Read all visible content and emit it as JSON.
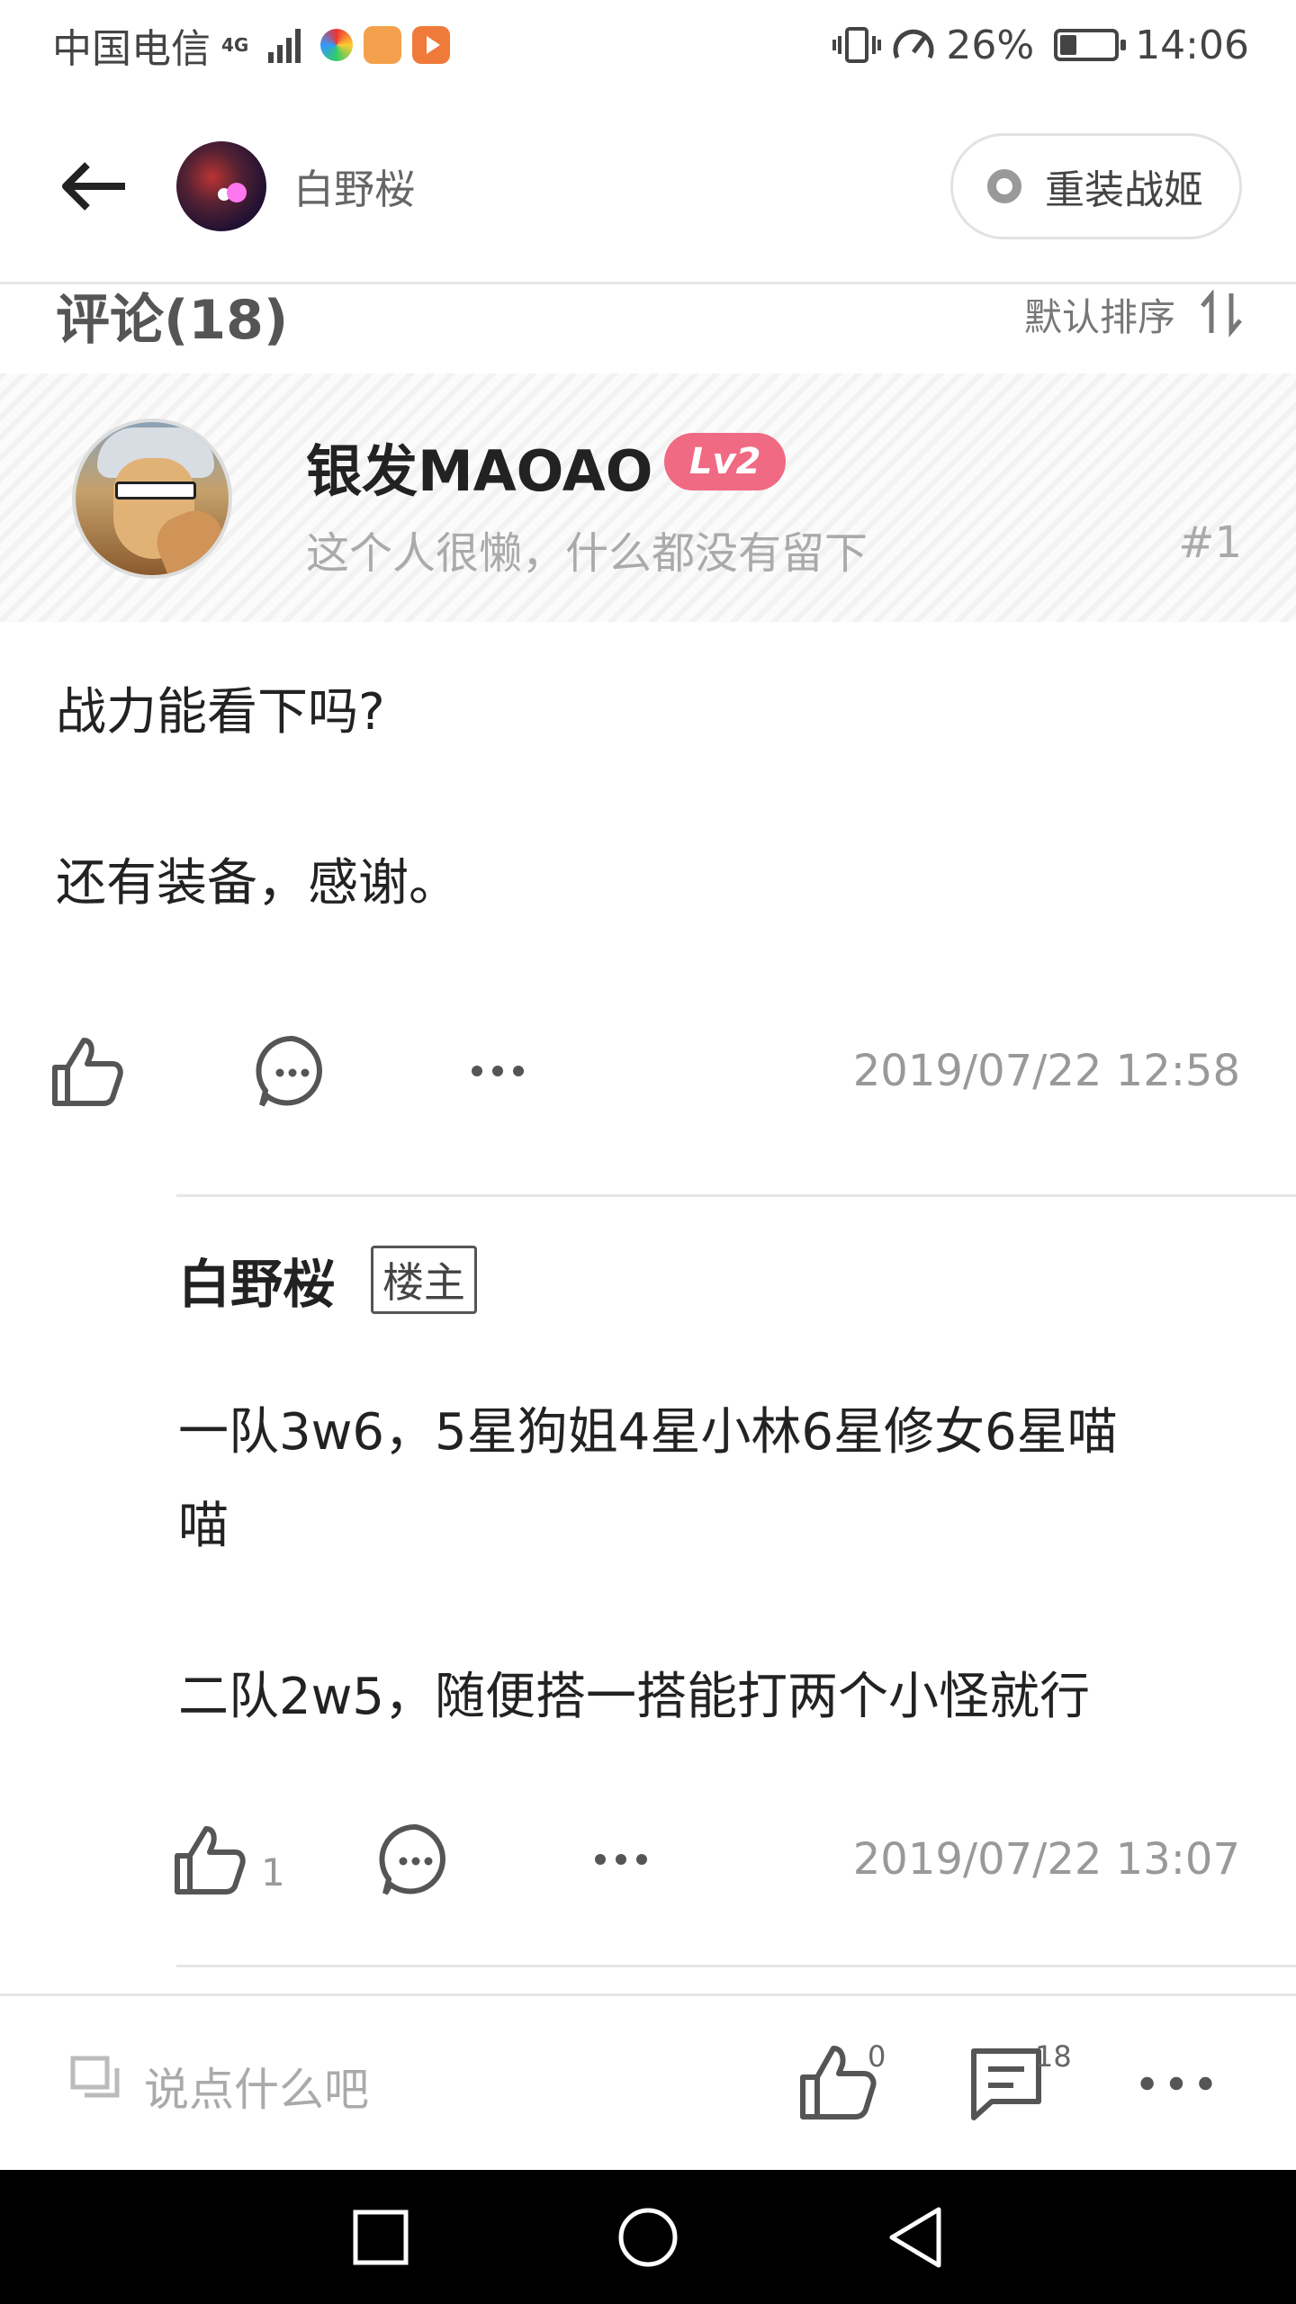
{
  "status_bar": {
    "carrier": "中国电信",
    "network": "4G",
    "battery": "26%",
    "time": "14:06"
  },
  "header": {
    "username": "白野桜",
    "circle_button": "重装战姬"
  },
  "comments_bar": {
    "title": "评论(18)",
    "sort_label": "默认排序"
  },
  "comment": {
    "user_name": "银发MAOAO",
    "level": "Lv2",
    "signature": "这个人很懒，什么都没有留下",
    "floor": "#1",
    "paragraphs": [
      "战力能看下吗?",
      "还有装备，感谢。"
    ],
    "timestamp": "2019/07/22 12:58"
  },
  "reply": {
    "user_name": "白野桜",
    "badge": "楼主",
    "line1": "一队3w6，5星狗姐4星小林6星修女6星喵",
    "line2": "喵",
    "line3": "二队2w5，随便搭一搭能打两个小怪就行",
    "likes": "1",
    "timestamp": "2019/07/22 13:07"
  },
  "input_bar": {
    "placeholder": "说点什么吧",
    "like_count": "0",
    "comment_count": "18"
  },
  "colors": {
    "level_badge": "#f06a84",
    "text_primary": "#222222",
    "text_muted": "#999999",
    "nav_bar": "#000000"
  }
}
